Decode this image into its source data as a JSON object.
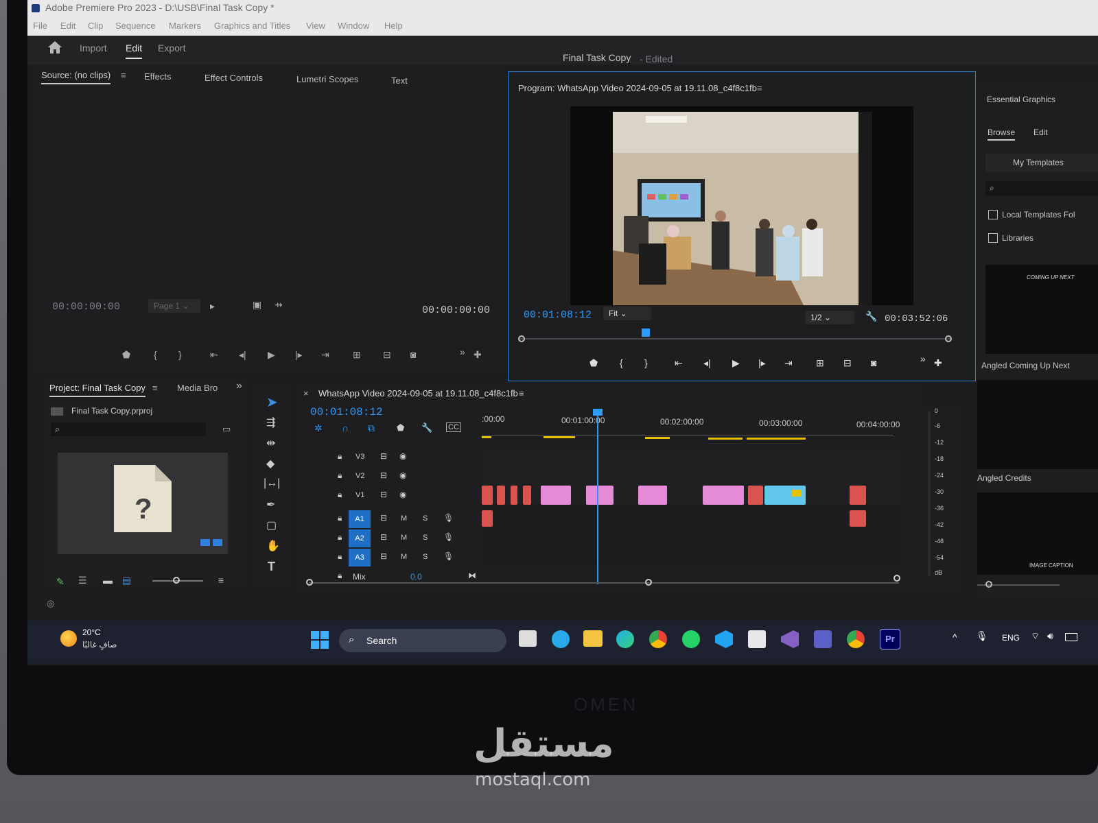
{
  "window": {
    "title": "Adobe Premiere Pro 2023 - D:\\USB\\Final Task Copy *"
  },
  "menu": [
    "File",
    "Edit",
    "Clip",
    "Sequence",
    "Markers",
    "Graphics and Titles",
    "View",
    "Window",
    "Help"
  ],
  "workspace": {
    "tabs": [
      "Import",
      "Edit",
      "Export"
    ],
    "active": "Edit",
    "project_title": "Final Task Copy",
    "status": "- Edited"
  },
  "source_panel": {
    "tabs": [
      "Source: (no clips)",
      "Effects",
      "Effect Controls",
      "Lumetri Scopes",
      "Text"
    ],
    "timecode_in": "00:00:00:00",
    "page_select": "Page 1",
    "timecode_out": "00:00:00:00"
  },
  "program_panel": {
    "title": "Program: WhatsApp Video 2024-09-05 at 19.11.08_c4f8c1fb",
    "timecode": "00:01:08:12",
    "fit": "Fit",
    "resolution": "1/2",
    "duration": "00:03:52:06"
  },
  "essential_graphics": {
    "title": "Essential Graphics",
    "tabs": [
      "Browse",
      "Edit"
    ],
    "my_templates": "My Templates",
    "checkboxes": [
      "Local Templates Fol",
      "Libraries"
    ],
    "templates": [
      "Angled Coming Up Next",
      "Angled Credits"
    ],
    "thumb_text_1": "COMING UP NEXT",
    "thumb_text_2": "IMAGE CAPTION"
  },
  "project_panel": {
    "tabs": [
      "Project: Final Task Copy",
      "Media Bro"
    ],
    "file": "Final Task Copy.prproj"
  },
  "timeline": {
    "sequence_name": "WhatsApp Video 2024-09-05 at 19.11.08_c4f8c1fb",
    "timecode": "00:01:08:12",
    "ruler": [
      ":00:00",
      "00:01:00:00",
      "00:02:00:00",
      "00:03:00:00",
      "00:04:00:00"
    ],
    "video_tracks": [
      "V3",
      "V2",
      "V1"
    ],
    "audio_tracks": [
      "A1",
      "A2",
      "A3"
    ],
    "mix_label": "Mix",
    "mix_value": "0.0",
    "m_label": "M",
    "s_label": "S"
  },
  "meter": {
    "scale": [
      "0",
      "-6",
      "-12",
      "-18",
      "-24",
      "-30",
      "-36",
      "-42",
      "-48",
      "-54",
      "dB"
    ]
  },
  "taskbar": {
    "weather_temp": "20°C",
    "weather_desc": "صافٍ غالبًا",
    "search": "Search",
    "lang": "ENG"
  },
  "watermark": {
    "arabic": "مستقل",
    "latin": "mostaql.com"
  },
  "brand": "OMEN",
  "colors": {
    "accent": "#2e9bff",
    "clip_pink": "#e58bd8",
    "clip_red": "#d9534f",
    "clip_cyan": "#5fc8ea"
  }
}
